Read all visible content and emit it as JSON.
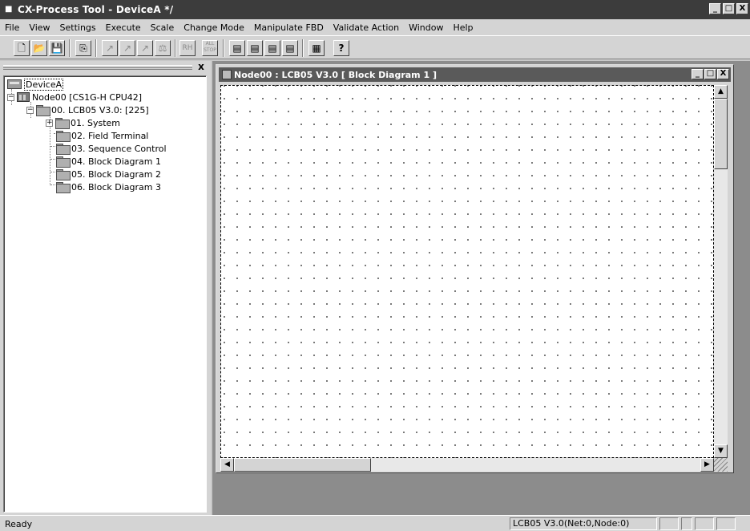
{
  "window": {
    "title": "CX-Process Tool - DeviceA */",
    "minimize": "_",
    "maximize": "□",
    "close": "X"
  },
  "menu": [
    "File",
    "View",
    "Settings",
    "Execute",
    "Scale",
    "Change Mode",
    "Manipulate FBD",
    "Validate Action",
    "Window",
    "Help"
  ],
  "toolbar": [
    {
      "icon": "new-file-icon",
      "glyph": "🗋",
      "enabled": true
    },
    {
      "icon": "open-folder-icon",
      "glyph": "📂",
      "enabled": true
    },
    {
      "icon": "save-icon",
      "glyph": "💾",
      "enabled": true
    },
    {
      "icon": "copy-icon",
      "glyph": "⎘",
      "enabled": true
    },
    {
      "icon": "transfer-up-icon",
      "glyph": "↗",
      "enabled": false
    },
    {
      "icon": "transfer-down-icon",
      "glyph": "↗",
      "enabled": false
    },
    {
      "icon": "compare-icon",
      "glyph": "↗",
      "enabled": false
    },
    {
      "icon": "verify-icon",
      "glyph": "⚖",
      "enabled": false
    },
    {
      "icon": "run-icon",
      "glyph": "RH",
      "enabled": false
    },
    {
      "icon": "all-stop-icon",
      "glyph": "ALL STOP",
      "enabled": false
    },
    {
      "icon": "list-view-1-icon",
      "glyph": "▤",
      "enabled": true
    },
    {
      "icon": "list-view-2-icon",
      "glyph": "▤",
      "enabled": true
    },
    {
      "icon": "list-view-3-icon",
      "glyph": "▤",
      "enabled": true
    },
    {
      "icon": "list-view-4-icon",
      "glyph": "▤",
      "enabled": true
    },
    {
      "icon": "table-icon",
      "glyph": "▦",
      "enabled": true
    },
    {
      "icon": "help-icon",
      "glyph": "?",
      "enabled": true
    }
  ],
  "tree": {
    "close": "x",
    "items": [
      {
        "label": "DeviceA",
        "icon": "device-icon"
      },
      {
        "label": "Node00 [CS1G-H CPU42]",
        "icon": "cpu-icon",
        "expander": "−"
      },
      {
        "label": "00. LCB05 V3.0: [225]",
        "icon": "folder-icon",
        "expander": "−"
      },
      {
        "label": "01. System",
        "icon": "folder-icon",
        "expander": "+"
      },
      {
        "label": "02. Field Terminal",
        "icon": "folder-icon"
      },
      {
        "label": "03. Sequence Control",
        "icon": "folder-icon"
      },
      {
        "label": "04. Block Diagram 1",
        "icon": "folder-icon"
      },
      {
        "label": "05. Block Diagram 2",
        "icon": "folder-icon"
      },
      {
        "label": "06. Block Diagram 3",
        "icon": "folder-icon"
      }
    ]
  },
  "child_window": {
    "title": "Node00 : LCB05 V3.0 [ Block Diagram 1 ]",
    "minimize": "_",
    "maximize": "□",
    "close": "X"
  },
  "scroll": {
    "up": "▲",
    "down": "▼",
    "left": "◀",
    "right": "▶"
  },
  "status": {
    "text": "Ready",
    "connection": "LCB05 V3.0(Net:0,Node:0)"
  }
}
